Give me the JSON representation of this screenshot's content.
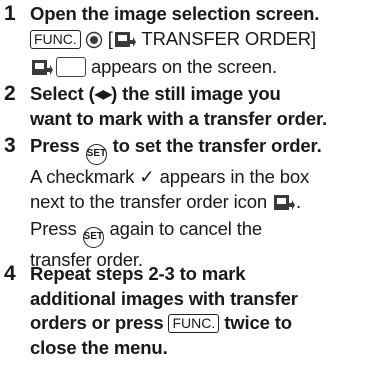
{
  "steps": [
    {
      "num": "1",
      "title": "Open the image selection screen.",
      "func_key": "FUNC.",
      "menu_open": "[",
      "menu_item": " TRANSFER ORDER]",
      "screen_note": "appears on the screen."
    },
    {
      "num": "2",
      "title_a": "Select (",
      "title_arrows": "◀▶",
      "title_b": ") the still image you",
      "title_line2": "want to mark with a transfer order."
    },
    {
      "num": "3",
      "title_a": "Press",
      "set_label": "SET",
      "title_b": "to set the transfer order.",
      "body_line1": "A checkmark ✓ appears in the box",
      "body_line2_a": "next to the transfer order icon",
      "body_line2_b": ".",
      "body_line3_a": "Press",
      "body_line3_b": "again to cancel the",
      "body_line4": "transfer order."
    },
    {
      "num": "4",
      "line1": "Repeat steps 2-3 to mark",
      "line2": "additional images with transfer",
      "line3_a": "orders or press",
      "func_key": "FUNC.",
      "line3_b": "twice to",
      "line4": "close the menu."
    }
  ],
  "icons": {
    "dial": "control-dial-icon",
    "transfer": "transfer-order-icon",
    "checkbox": "empty-checkbox-icon",
    "set_button": "set-button-icon"
  },
  "colors": {
    "text": "#1a1a1a",
    "icon_fill": "#3a3a3a"
  }
}
